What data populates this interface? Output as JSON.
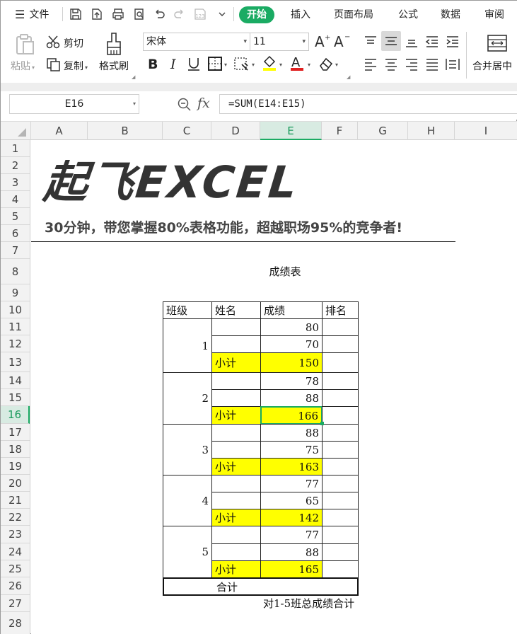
{
  "menu": {
    "file_label": "文件",
    "tabs": [
      "开始",
      "插入",
      "页面布局",
      "公式",
      "数据",
      "审阅"
    ],
    "active_tab": "开始"
  },
  "ribbon": {
    "paste_label": "粘贴",
    "cut_label": "剪切",
    "copy_label": "复制",
    "format_painter_label": "格式刷",
    "font_name": "宋体",
    "font_size": "11",
    "merge_label": "合并居中"
  },
  "formula_bar": {
    "cell_ref": "E16",
    "fx_label": "fx",
    "formula": "=SUM(E14:E15)"
  },
  "columns": [
    "A",
    "B",
    "C",
    "D",
    "E",
    "F",
    "G",
    "H",
    "I"
  ],
  "selected_column": "E",
  "rows": [
    "1",
    "2",
    "3",
    "4",
    "5",
    "6",
    "7",
    "8",
    "9",
    "10",
    "11",
    "12",
    "13",
    "14",
    "15",
    "16",
    "17",
    "18",
    "19",
    "20",
    "21",
    "22",
    "23",
    "24",
    "25",
    "26",
    "27",
    "28"
  ],
  "selected_row": "16",
  "banner": {
    "logo": "起飞EXCEL",
    "slogan": "30分钟，带您掌握80%表格功能，超越职场95%的竞争者!"
  },
  "table": {
    "title": "成绩表",
    "headers": [
      "班级",
      "姓名",
      "成绩",
      "排名"
    ],
    "groups": [
      {
        "class": "1",
        "scores": [
          "80",
          "70"
        ],
        "subtotal_label": "小计",
        "subtotal": "150"
      },
      {
        "class": "2",
        "scores": [
          "78",
          "88"
        ],
        "subtotal_label": "小计",
        "subtotal": "166"
      },
      {
        "class": "3",
        "scores": [
          "88",
          "75"
        ],
        "subtotal_label": "小计",
        "subtotal": "163"
      },
      {
        "class": "4",
        "scores": [
          "77",
          "65"
        ],
        "subtotal_label": "小计",
        "subtotal": "142"
      },
      {
        "class": "5",
        "scores": [
          "77",
          "88"
        ],
        "subtotal_label": "小计",
        "subtotal": "165"
      }
    ],
    "total_label": "合计",
    "note": "对1-5班总成绩合计"
  },
  "colors": {
    "accent": "#1aab63",
    "highlight": "#ffff00"
  }
}
